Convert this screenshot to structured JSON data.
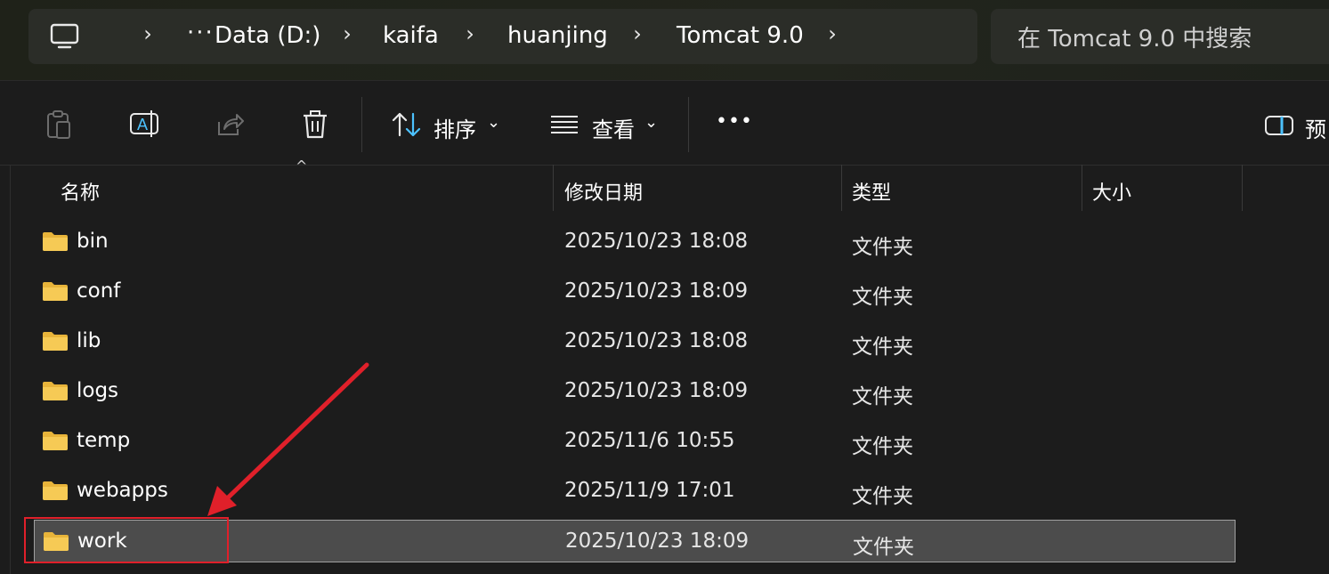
{
  "address_bar": {
    "ellipsis": "···",
    "crumbs": [
      "Data (D:)",
      "kaifa",
      "huanjing",
      "Tomcat 9.0"
    ]
  },
  "search": {
    "placeholder": "在 Tomcat 9.0 中搜索"
  },
  "toolbar": {
    "sort_label": "排序",
    "view_label": "查看",
    "more_label": "•••",
    "preview_label": "预"
  },
  "columns": {
    "name": "名称",
    "modified": "修改日期",
    "type": "类型",
    "size": "大小"
  },
  "files": [
    {
      "name": "bin",
      "modified": "2025/10/23 18:08",
      "type": "文件夹"
    },
    {
      "name": "conf",
      "modified": "2025/10/23 18:09",
      "type": "文件夹"
    },
    {
      "name": "lib",
      "modified": "2025/10/23 18:08",
      "type": "文件夹"
    },
    {
      "name": "logs",
      "modified": "2025/10/23 18:09",
      "type": "文件夹"
    },
    {
      "name": "temp",
      "modified": "2025/11/6 10:55",
      "type": "文件夹"
    },
    {
      "name": "webapps",
      "modified": "2025/11/9 17:01",
      "type": "文件夹"
    },
    {
      "name": "work",
      "modified": "2025/10/23 18:09",
      "type": "文件夹"
    }
  ],
  "colors": {
    "folder": "#f3c24a",
    "annotation": "#e0202a",
    "accent": "#4cc2ff"
  }
}
